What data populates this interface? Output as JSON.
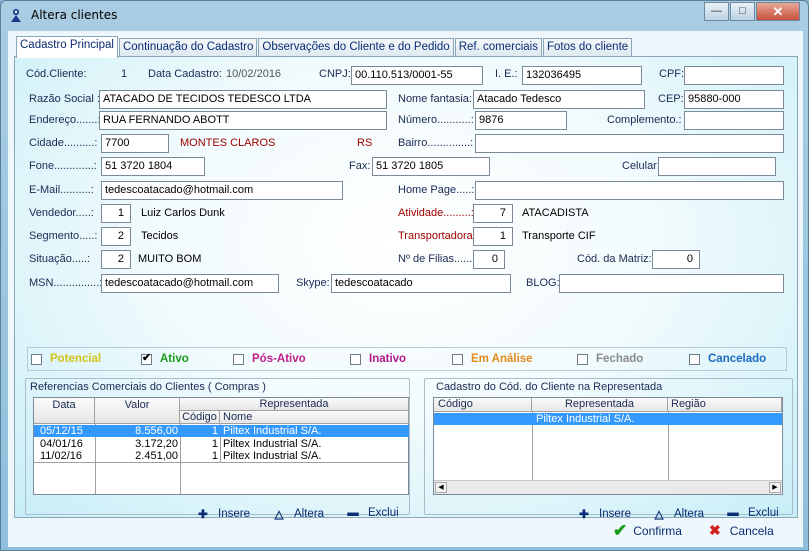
{
  "window": {
    "title": "Altera clientes",
    "minimize": "—",
    "maximize": "□",
    "close": "✕"
  },
  "tabs": [
    "Cadastro Principal",
    "Continuação do Cadastro",
    "Observações do Cliente e do Pedido",
    "Ref. comerciais",
    "Fotos do cliente"
  ],
  "form": {
    "cod_cliente_label": "Cód.Cliente:",
    "cod_cliente": "1",
    "data_cadastro_label": "Data Cadastro:",
    "data_cadastro": "10/02/2016",
    "cnpj_label": "CNPJ:",
    "cnpj": "00.110.513/0001-55",
    "ie_label": "I. E.:",
    "ie": "132036495",
    "cpf_label": "CPF:",
    "cpf": "",
    "razao_label": "Razão Social :",
    "razao": "ATACADO DE TECIDOS TEDESCO LTDA",
    "fantasia_label": "Nome fantasia:",
    "fantasia": "Atacado Tedesco",
    "cep_label": "CEP:",
    "cep": "95880-000",
    "endereco_label": "Endereço.......:",
    "endereco": "RUA FERNANDO ABOTT",
    "numero_label": "Número...........:",
    "numero": "9876",
    "complemento_label": "Complemento.:",
    "complemento": "",
    "cidade_label": "Cidade..........:",
    "cidade_cod": "7700",
    "cidade_nome": "MONTES CLAROS",
    "uf": "RS",
    "bairro_label": "Bairro..............:",
    "bairro": "",
    "fone_label": "Fone.............:",
    "fone": "51 3720 1804",
    "fax_label": "Fax:",
    "fax": "51 3720 1805",
    "celular_label": "Celular:",
    "celular": "",
    "email_label": "E-Mail..........:",
    "email": "tedescoatacado@hotmail.com",
    "homepage_label": "Home Page.....:",
    "homepage": "",
    "vendedor_label": "Vendedor.....:",
    "vendedor_cod": "1",
    "vendedor_nome": "Luiz Carlos Dunk",
    "atividade_label": "Atividade.........:",
    "atividade_cod": "7",
    "atividade_nome": "ATACADISTA",
    "segmento_label": "Segmento.....:",
    "segmento_cod": "2",
    "segmento_nome": "Tecidos",
    "transportadora_label": "Transportadora:",
    "transportadora_cod": "1",
    "transportadora_nome": "Transporte CIF",
    "situacao_label": "Situação.....:",
    "situacao_cod": "2",
    "situacao_nome": "MUITO BOM",
    "filiais_label": "Nº de Filias......:",
    "filiais": "0",
    "matriz_label": "Cód. da Matriz:",
    "matriz": "0",
    "msn_label": "MSN...............:",
    "msn": "tedescoatacado@hotmail.com",
    "skype_label": "Skype:",
    "skype": "tedescoatacado",
    "blog_label": "BLOG:",
    "blog": ""
  },
  "status_options": [
    {
      "label": "Potencial",
      "color": "#d4c21a",
      "checked": false
    },
    {
      "label": "Ativo",
      "color": "#1a9a1a",
      "checked": true
    },
    {
      "label": "Pós-Ativo",
      "color": "#c0208a",
      "checked": false
    },
    {
      "label": "Inativo",
      "color": "#b01a8a",
      "checked": false
    },
    {
      "label": "Em Análise",
      "color": "#e08a1a",
      "checked": false
    },
    {
      "label": "Fechado",
      "color": "#8a8a8a",
      "checked": false
    },
    {
      "label": "Cancelado",
      "color": "#1a6ac0",
      "checked": false
    }
  ],
  "ref_group": {
    "title": "Referencias Comerciais do Clientes ( Compras )",
    "headers": {
      "data": "Data",
      "valor": "Valor",
      "representada": "Representada",
      "codigo": "Código",
      "nome": "Nome"
    },
    "rows": [
      {
        "data": "05/12/15",
        "valor": "8.556,00",
        "codigo": "1",
        "nome": "Piltex Industrial S/A."
      },
      {
        "data": "04/01/16",
        "valor": "3.172,20",
        "codigo": "1",
        "nome": "Piltex Industrial S/A."
      },
      {
        "data": "11/02/16",
        "valor": "2.451,00",
        "codigo": "1",
        "nome": "Piltex Industrial S/A."
      }
    ],
    "insere": "Insere",
    "altera": "Altera",
    "exclui": "Exclui"
  },
  "rep_group": {
    "title": "Cadastro do Cód. do Cliente na Representada",
    "headers": {
      "codigo": "Código",
      "representada": "Representada",
      "regiao": "Região"
    },
    "rows": [
      {
        "codigo": "",
        "representada": "Piltex Industrial S/A.",
        "regiao": ""
      }
    ],
    "insere": "Insere",
    "altera": "Altera",
    "exclui": "Exclui"
  },
  "footer": {
    "confirma": "Confirma",
    "cancela": "Cancela"
  }
}
